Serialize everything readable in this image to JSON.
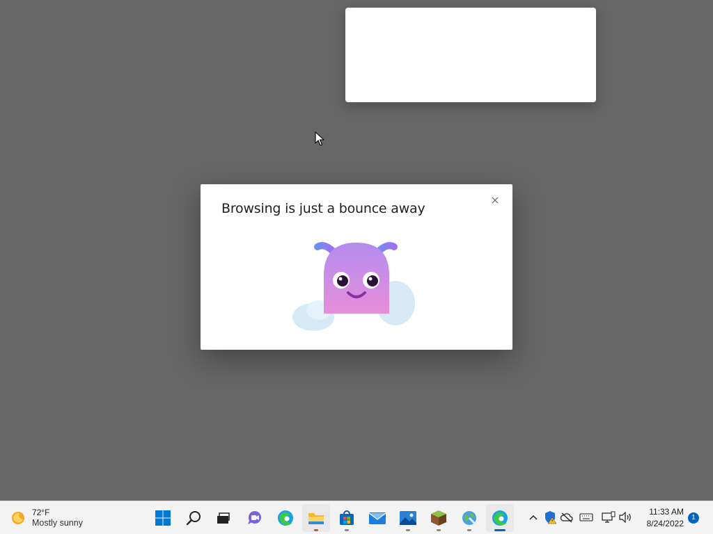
{
  "dialog": {
    "title": "Browsing is just a bounce away",
    "close_icon": "close-icon",
    "illustration": "mascot-illustration"
  },
  "taskbar": {
    "weather": {
      "temperature": "72°F",
      "condition": "Mostly sunny",
      "icon": "sun-icon"
    },
    "pinned": [
      {
        "name": "start",
        "icon": "windows-start-icon"
      },
      {
        "name": "search",
        "icon": "search-icon"
      },
      {
        "name": "task-view",
        "icon": "task-view-icon"
      },
      {
        "name": "teams-chat",
        "icon": "chat-icon"
      },
      {
        "name": "edge",
        "icon": "edge-icon"
      },
      {
        "name": "file-explorer",
        "icon": "folder-icon"
      },
      {
        "name": "microsoft-store",
        "icon": "store-icon"
      },
      {
        "name": "mail",
        "icon": "mail-icon"
      },
      {
        "name": "photos",
        "icon": "photos-icon"
      },
      {
        "name": "minecraft",
        "icon": "minecraft-icon"
      },
      {
        "name": "maps",
        "icon": "maps-icon"
      },
      {
        "name": "edge-active",
        "icon": "edge-icon"
      }
    ],
    "tray": {
      "icons": [
        "chevron-up-icon",
        "security-warning-icon",
        "cloud-offline-icon",
        "keyboard-icon",
        "network-icon",
        "volume-icon"
      ]
    },
    "clock": {
      "time": "11:33 AM",
      "date": "8/24/2022"
    },
    "notification_count": "1"
  }
}
